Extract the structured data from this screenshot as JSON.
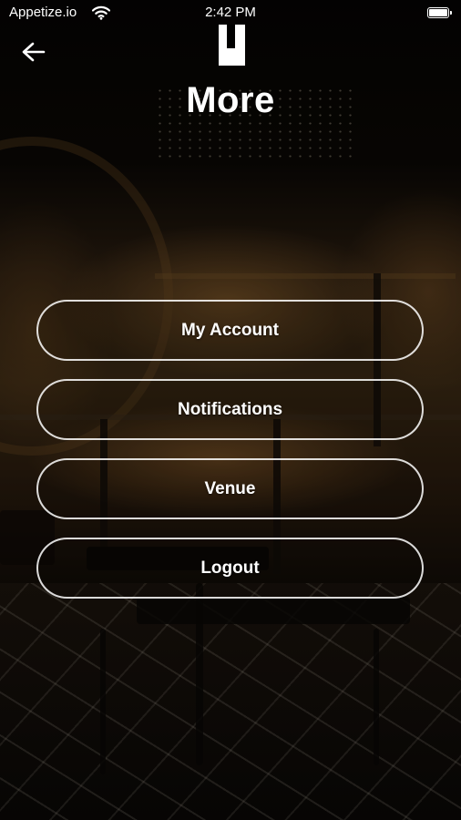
{
  "status_bar": {
    "carrier": "Appetize.io",
    "time": "2:42 PM",
    "wifi_icon": "wifi-icon",
    "battery_icon": "battery-full-icon"
  },
  "nav": {
    "back_icon": "arrow-left-icon",
    "logo_icon": "venue-logo"
  },
  "page": {
    "title": "More"
  },
  "menu": {
    "items": [
      {
        "label": "My Account"
      },
      {
        "label": "Notifications"
      },
      {
        "label": "Venue"
      },
      {
        "label": "Logout"
      }
    ]
  },
  "colors": {
    "text": "#ffffff",
    "button_border": "#ffffff",
    "background": "#0c0906"
  }
}
